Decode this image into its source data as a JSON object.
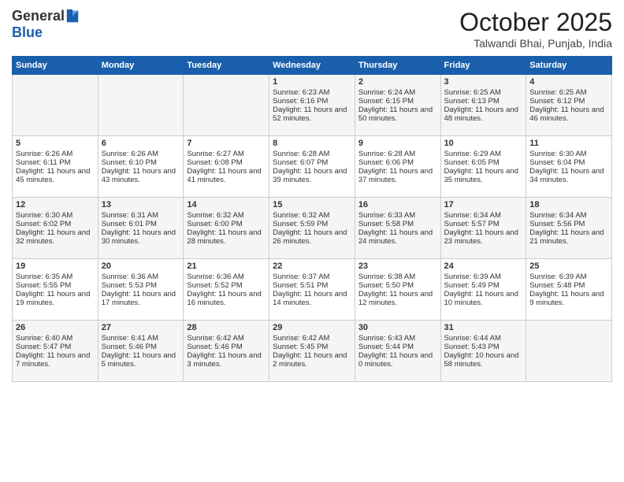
{
  "header": {
    "logo_general": "General",
    "logo_blue": "Blue",
    "month_title": "October 2025",
    "location": "Talwandi Bhai, Punjab, India"
  },
  "days_of_week": [
    "Sunday",
    "Monday",
    "Tuesday",
    "Wednesday",
    "Thursday",
    "Friday",
    "Saturday"
  ],
  "weeks": [
    [
      {
        "day": "",
        "sunrise": "",
        "sunset": "",
        "daylight": ""
      },
      {
        "day": "",
        "sunrise": "",
        "sunset": "",
        "daylight": ""
      },
      {
        "day": "",
        "sunrise": "",
        "sunset": "",
        "daylight": ""
      },
      {
        "day": "1",
        "sunrise": "Sunrise: 6:23 AM",
        "sunset": "Sunset: 6:16 PM",
        "daylight": "Daylight: 11 hours and 52 minutes."
      },
      {
        "day": "2",
        "sunrise": "Sunrise: 6:24 AM",
        "sunset": "Sunset: 6:15 PM",
        "daylight": "Daylight: 11 hours and 50 minutes."
      },
      {
        "day": "3",
        "sunrise": "Sunrise: 6:25 AM",
        "sunset": "Sunset: 6:13 PM",
        "daylight": "Daylight: 11 hours and 48 minutes."
      },
      {
        "day": "4",
        "sunrise": "Sunrise: 6:25 AM",
        "sunset": "Sunset: 6:12 PM",
        "daylight": "Daylight: 11 hours and 46 minutes."
      }
    ],
    [
      {
        "day": "5",
        "sunrise": "Sunrise: 6:26 AM",
        "sunset": "Sunset: 6:11 PM",
        "daylight": "Daylight: 11 hours and 45 minutes."
      },
      {
        "day": "6",
        "sunrise": "Sunrise: 6:26 AM",
        "sunset": "Sunset: 6:10 PM",
        "daylight": "Daylight: 11 hours and 43 minutes."
      },
      {
        "day": "7",
        "sunrise": "Sunrise: 6:27 AM",
        "sunset": "Sunset: 6:08 PM",
        "daylight": "Daylight: 11 hours and 41 minutes."
      },
      {
        "day": "8",
        "sunrise": "Sunrise: 6:28 AM",
        "sunset": "Sunset: 6:07 PM",
        "daylight": "Daylight: 11 hours and 39 minutes."
      },
      {
        "day": "9",
        "sunrise": "Sunrise: 6:28 AM",
        "sunset": "Sunset: 6:06 PM",
        "daylight": "Daylight: 11 hours and 37 minutes."
      },
      {
        "day": "10",
        "sunrise": "Sunrise: 6:29 AM",
        "sunset": "Sunset: 6:05 PM",
        "daylight": "Daylight: 11 hours and 35 minutes."
      },
      {
        "day": "11",
        "sunrise": "Sunrise: 6:30 AM",
        "sunset": "Sunset: 6:04 PM",
        "daylight": "Daylight: 11 hours and 34 minutes."
      }
    ],
    [
      {
        "day": "12",
        "sunrise": "Sunrise: 6:30 AM",
        "sunset": "Sunset: 6:02 PM",
        "daylight": "Daylight: 11 hours and 32 minutes."
      },
      {
        "day": "13",
        "sunrise": "Sunrise: 6:31 AM",
        "sunset": "Sunset: 6:01 PM",
        "daylight": "Daylight: 11 hours and 30 minutes."
      },
      {
        "day": "14",
        "sunrise": "Sunrise: 6:32 AM",
        "sunset": "Sunset: 6:00 PM",
        "daylight": "Daylight: 11 hours and 28 minutes."
      },
      {
        "day": "15",
        "sunrise": "Sunrise: 6:32 AM",
        "sunset": "Sunset: 5:59 PM",
        "daylight": "Daylight: 11 hours and 26 minutes."
      },
      {
        "day": "16",
        "sunrise": "Sunrise: 6:33 AM",
        "sunset": "Sunset: 5:58 PM",
        "daylight": "Daylight: 11 hours and 24 minutes."
      },
      {
        "day": "17",
        "sunrise": "Sunrise: 6:34 AM",
        "sunset": "Sunset: 5:57 PM",
        "daylight": "Daylight: 11 hours and 23 minutes."
      },
      {
        "day": "18",
        "sunrise": "Sunrise: 6:34 AM",
        "sunset": "Sunset: 5:56 PM",
        "daylight": "Daylight: 11 hours and 21 minutes."
      }
    ],
    [
      {
        "day": "19",
        "sunrise": "Sunrise: 6:35 AM",
        "sunset": "Sunset: 5:55 PM",
        "daylight": "Daylight: 11 hours and 19 minutes."
      },
      {
        "day": "20",
        "sunrise": "Sunrise: 6:36 AM",
        "sunset": "Sunset: 5:53 PM",
        "daylight": "Daylight: 11 hours and 17 minutes."
      },
      {
        "day": "21",
        "sunrise": "Sunrise: 6:36 AM",
        "sunset": "Sunset: 5:52 PM",
        "daylight": "Daylight: 11 hours and 16 minutes."
      },
      {
        "day": "22",
        "sunrise": "Sunrise: 6:37 AM",
        "sunset": "Sunset: 5:51 PM",
        "daylight": "Daylight: 11 hours and 14 minutes."
      },
      {
        "day": "23",
        "sunrise": "Sunrise: 6:38 AM",
        "sunset": "Sunset: 5:50 PM",
        "daylight": "Daylight: 11 hours and 12 minutes."
      },
      {
        "day": "24",
        "sunrise": "Sunrise: 6:39 AM",
        "sunset": "Sunset: 5:49 PM",
        "daylight": "Daylight: 11 hours and 10 minutes."
      },
      {
        "day": "25",
        "sunrise": "Sunrise: 6:39 AM",
        "sunset": "Sunset: 5:48 PM",
        "daylight": "Daylight: 11 hours and 9 minutes."
      }
    ],
    [
      {
        "day": "26",
        "sunrise": "Sunrise: 6:40 AM",
        "sunset": "Sunset: 5:47 PM",
        "daylight": "Daylight: 11 hours and 7 minutes."
      },
      {
        "day": "27",
        "sunrise": "Sunrise: 6:41 AM",
        "sunset": "Sunset: 5:46 PM",
        "daylight": "Daylight: 11 hours and 5 minutes."
      },
      {
        "day": "28",
        "sunrise": "Sunrise: 6:42 AM",
        "sunset": "Sunset: 5:46 PM",
        "daylight": "Daylight: 11 hours and 3 minutes."
      },
      {
        "day": "29",
        "sunrise": "Sunrise: 6:42 AM",
        "sunset": "Sunset: 5:45 PM",
        "daylight": "Daylight: 11 hours and 2 minutes."
      },
      {
        "day": "30",
        "sunrise": "Sunrise: 6:43 AM",
        "sunset": "Sunset: 5:44 PM",
        "daylight": "Daylight: 11 hours and 0 minutes."
      },
      {
        "day": "31",
        "sunrise": "Sunrise: 6:44 AM",
        "sunset": "Sunset: 5:43 PM",
        "daylight": "Daylight: 10 hours and 58 minutes."
      },
      {
        "day": "",
        "sunrise": "",
        "sunset": "",
        "daylight": ""
      }
    ]
  ]
}
